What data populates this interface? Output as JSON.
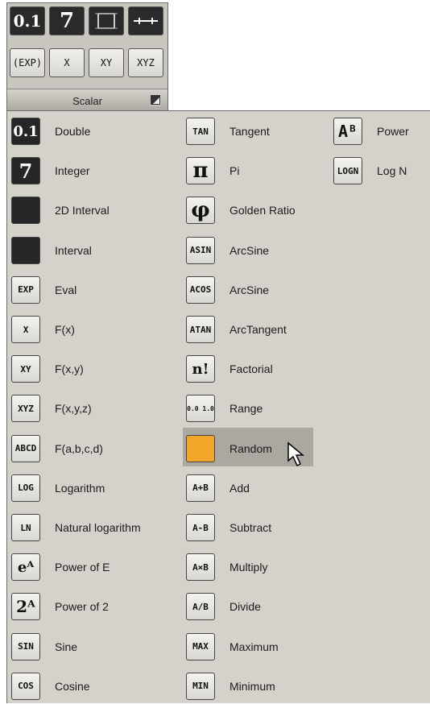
{
  "top_panel": {
    "icons": [
      {
        "text": "0.1",
        "name": "double-icon"
      },
      {
        "text": "7",
        "name": "integer-icon"
      },
      {
        "text": "",
        "name": "2d-interval-icon"
      },
      {
        "text": "",
        "name": "interval-icon"
      },
      {
        "text": "EXP",
        "name": "eval-icon"
      },
      {
        "text": "X",
        "name": "fx-icon"
      },
      {
        "text": "XY",
        "name": "fxy-icon"
      },
      {
        "text": "XYZ",
        "name": "fxyz-icon"
      }
    ],
    "title": "Scalar"
  },
  "menu": {
    "col1": [
      {
        "label": "Double",
        "icon": "0.1"
      },
      {
        "label": "Integer",
        "icon": "7"
      },
      {
        "label": "2D Interval",
        "icon": ""
      },
      {
        "label": "Interval",
        "icon": ""
      },
      {
        "label": "Eval",
        "icon": "EXP"
      },
      {
        "label": "F(x)",
        "icon": "X"
      },
      {
        "label": "F(x,y)",
        "icon": "XY"
      },
      {
        "label": "F(x,y,z)",
        "icon": "XYZ"
      },
      {
        "label": "F(a,b,c,d)",
        "icon": "ABCD"
      },
      {
        "label": "Logarithm",
        "icon": "LOG"
      },
      {
        "label": "Natural logarithm",
        "icon": "LN"
      },
      {
        "label": "Power of E",
        "icon": "eA"
      },
      {
        "label": "Power of 2",
        "icon": "2A"
      },
      {
        "label": "Sine",
        "icon": "SIN"
      },
      {
        "label": "Cosine",
        "icon": "COS"
      }
    ],
    "col2": [
      {
        "label": "Tangent",
        "icon": "TAN"
      },
      {
        "label": "Pi",
        "icon": "π"
      },
      {
        "label": "Golden Ratio",
        "icon": "φ"
      },
      {
        "label": "ArcSine",
        "icon": "ASIN"
      },
      {
        "label": "ArcSine",
        "icon": "ACOS"
      },
      {
        "label": "ArcTangent",
        "icon": "ATAN"
      },
      {
        "label": "Factorial",
        "icon": "n!"
      },
      {
        "label": "Range",
        "icon": "0.0 1.0"
      },
      {
        "label": "Random",
        "icon": "🎲"
      },
      {
        "label": "Add",
        "icon": "A+B"
      },
      {
        "label": "Subtract",
        "icon": "A-B"
      },
      {
        "label": "Multiply",
        "icon": "A×B"
      },
      {
        "label": "Divide",
        "icon": "A/B"
      },
      {
        "label": "Maximum",
        "icon": "MAX"
      },
      {
        "label": "Minimum",
        "icon": "MIN"
      }
    ],
    "col3": [
      {
        "label": "Power",
        "icon": "AB"
      },
      {
        "label": "Log N",
        "icon": "LOGN"
      }
    ]
  }
}
